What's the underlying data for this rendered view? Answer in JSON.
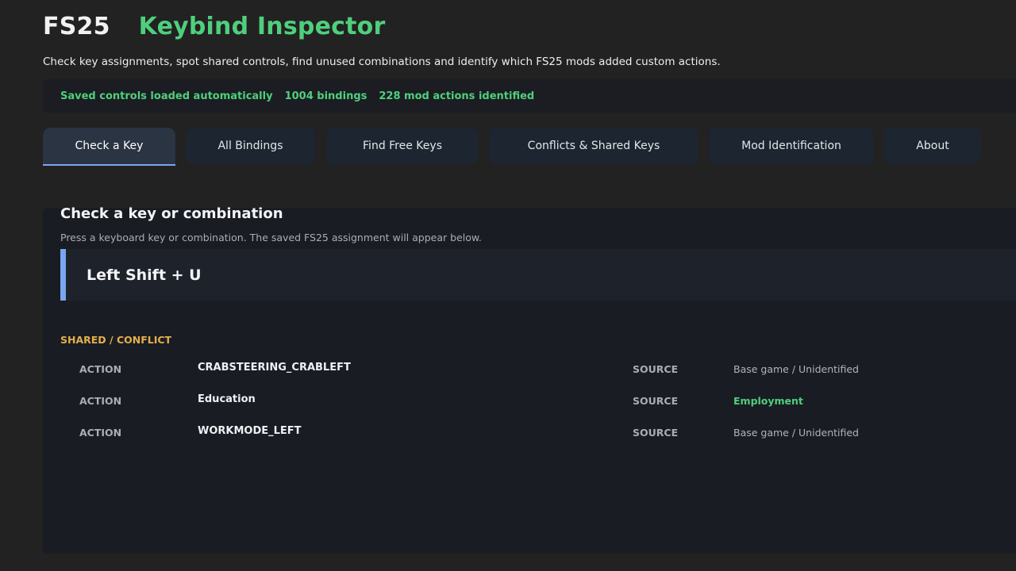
{
  "header": {
    "brand": "FS25",
    "title": "Keybind Inspector",
    "subtitle": "Check key assignments, spot shared controls, find unused combinations and identify which FS25 mods added custom actions."
  },
  "status": {
    "loaded": "Saved controls loaded automatically",
    "bindings": "1004 bindings",
    "mod_actions": "228 mod actions identified"
  },
  "tabs": [
    {
      "label": "Check a Key",
      "active": true
    },
    {
      "label": "All Bindings",
      "active": false
    },
    {
      "label": "Find Free Keys",
      "active": false
    },
    {
      "label": "Conflicts & Shared Keys",
      "active": false
    },
    {
      "label": "Mod Identification",
      "active": false
    },
    {
      "label": "About",
      "active": false
    }
  ],
  "check": {
    "title": "Check a key or combination",
    "hint": "Press a keyboard key or combination. The saved FS25 assignment will appear below.",
    "key": "Left Shift + U",
    "section_label": "SHARED / CONFLICT",
    "action_label": "ACTION",
    "source_label": "SOURCE",
    "rows": [
      {
        "action": "CRABSTEERING_CRABLEFT",
        "source": "Base game / Unidentified"
      },
      {
        "action": "Education",
        "source": "Employment"
      },
      {
        "action": "WORKMODE_LEFT",
        "source": "Base game / Unidentified"
      }
    ]
  },
  "colors": {
    "accent_green": "#4fcf7d",
    "accent_blue": "#7aa6f0",
    "warning": "#e3b04b",
    "background": "#222222"
  }
}
